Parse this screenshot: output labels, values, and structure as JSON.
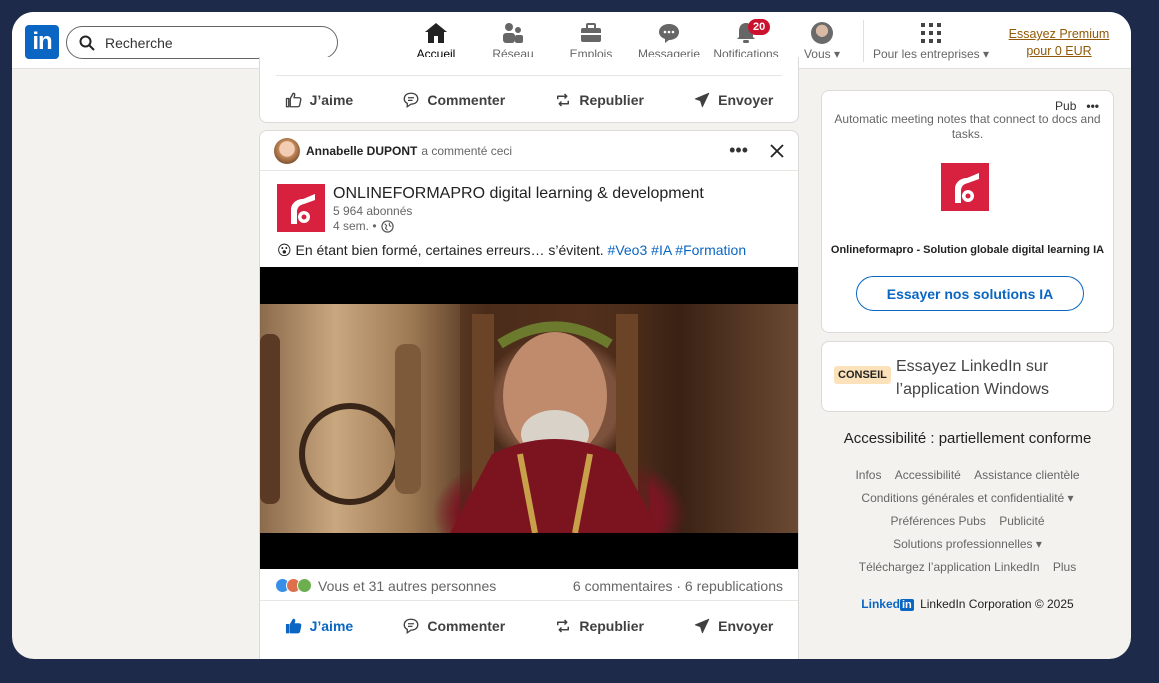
{
  "nav": {
    "logo_text": "in",
    "search_placeholder": "Recherche",
    "items": [
      {
        "label": "Accueil",
        "icon": "home-icon",
        "active": true
      },
      {
        "label": "Réseau",
        "icon": "network-icon"
      },
      {
        "label": "Emplois",
        "icon": "briefcase-icon"
      },
      {
        "label": "Messagerie",
        "icon": "messaging-icon"
      },
      {
        "label": "Notifications",
        "icon": "bell-icon",
        "badge": "20"
      },
      {
        "label": "Vous",
        "icon": "avatar-icon"
      },
      {
        "label": "Pour les entreprises",
        "icon": "grid-icon"
      }
    ],
    "premium": "Essayez Premium pour 0 EUR"
  },
  "prev_post": {
    "actions": [
      "J’aime",
      "Commenter",
      "Republier",
      "Envoyer"
    ]
  },
  "post": {
    "commenter_name": "Annabelle DUPONT",
    "commenter_action": "a commenté ceci",
    "company": "ONLINEFORMAPRO digital learning & development",
    "followers": "5 964 abonnés",
    "age": "4 sem. •",
    "emoji": "😮",
    "text": "En étant bien formé, certaines erreurs… s’évitent.",
    "hashtags": [
      "#Veo3",
      "#IA",
      "#Formation"
    ],
    "reactions_text": "Vous et 31 autres personnes",
    "counts_text": "6 commentaires · 6 republications",
    "actions": [
      "J’aime",
      "Commenter",
      "Republier",
      "Envoyer"
    ]
  },
  "ad": {
    "pub_label": "Pub",
    "tagline": "Automatic meeting notes that connect to docs and tasks.",
    "title": "Onlineformapro - Solution globale digital learning IA",
    "cta": "Essayer nos solutions IA"
  },
  "tip": {
    "badge": "CONSEIL",
    "text": "Essayez LinkedIn sur l’application Windows"
  },
  "accessibility": "Accessibilité : partiellement conforme",
  "footer": {
    "rows": [
      [
        "Infos",
        "Accessibilité",
        "Assistance clientèle"
      ],
      [
        "Conditions générales et confidentialité ▾"
      ],
      [
        "Préférences Pubs",
        "Publicité"
      ],
      [
        "Solutions professionnelles ▾"
      ],
      [
        "Téléchargez l’application LinkedIn",
        "Plus"
      ]
    ],
    "brand_word": "Linked",
    "brand_box": "in",
    "copyright": "LinkedIn Corporation © 2025"
  },
  "colors": {
    "brand": "#0a66c2",
    "badge": "#cb112d",
    "premium": "#915907",
    "company_logo": "#d8203f"
  }
}
